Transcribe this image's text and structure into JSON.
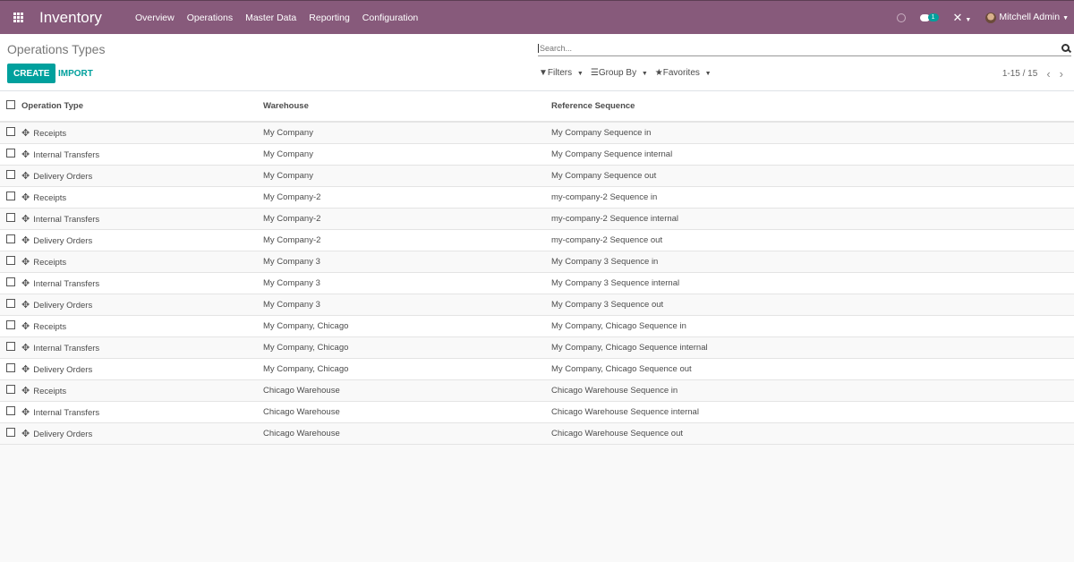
{
  "navbar": {
    "app_name": "Inventory",
    "menu": [
      "Overview",
      "Operations",
      "Master Data",
      "Reporting",
      "Configuration"
    ],
    "chat_badge": "1",
    "user_name": "Mitchell Admin",
    "brand_color": "#875a7b"
  },
  "control": {
    "title": "Operations Types",
    "create_label": "CREATE",
    "import_label": "IMPORT",
    "search_placeholder": "Search...",
    "filters_label": "Filters",
    "groupby_label": "Group By",
    "favorites_label": "Favorites",
    "pager": "1-15 / 15",
    "accent_color": "#00a09d"
  },
  "table": {
    "headers": [
      "Operation Type",
      "Warehouse",
      "Reference Sequence"
    ],
    "rows": [
      [
        "Receipts",
        "My Company",
        "My Company Sequence in"
      ],
      [
        "Internal Transfers",
        "My Company",
        "My Company Sequence internal"
      ],
      [
        "Delivery Orders",
        "My Company",
        "My Company Sequence out"
      ],
      [
        "Receipts",
        "My Company-2",
        "my-company-2 Sequence in"
      ],
      [
        "Internal Transfers",
        "My Company-2",
        "my-company-2 Sequence internal"
      ],
      [
        "Delivery Orders",
        "My Company-2",
        "my-company-2 Sequence out"
      ],
      [
        "Receipts",
        "My Company 3",
        "My Company 3 Sequence in"
      ],
      [
        "Internal Transfers",
        "My Company 3",
        "My Company 3 Sequence internal"
      ],
      [
        "Delivery Orders",
        "My Company 3",
        "My Company 3 Sequence out"
      ],
      [
        "Receipts",
        "My Company, Chicago",
        "My Company, Chicago Sequence in"
      ],
      [
        "Internal Transfers",
        "My Company, Chicago",
        "My Company, Chicago Sequence internal"
      ],
      [
        "Delivery Orders",
        "My Company, Chicago",
        "My Company, Chicago Sequence out"
      ],
      [
        "Receipts",
        "Chicago Warehouse",
        "Chicago Warehouse Sequence in"
      ],
      [
        "Internal Transfers",
        "Chicago Warehouse",
        "Chicago Warehouse Sequence internal"
      ],
      [
        "Delivery Orders",
        "Chicago Warehouse",
        "Chicago Warehouse Sequence out"
      ]
    ]
  }
}
